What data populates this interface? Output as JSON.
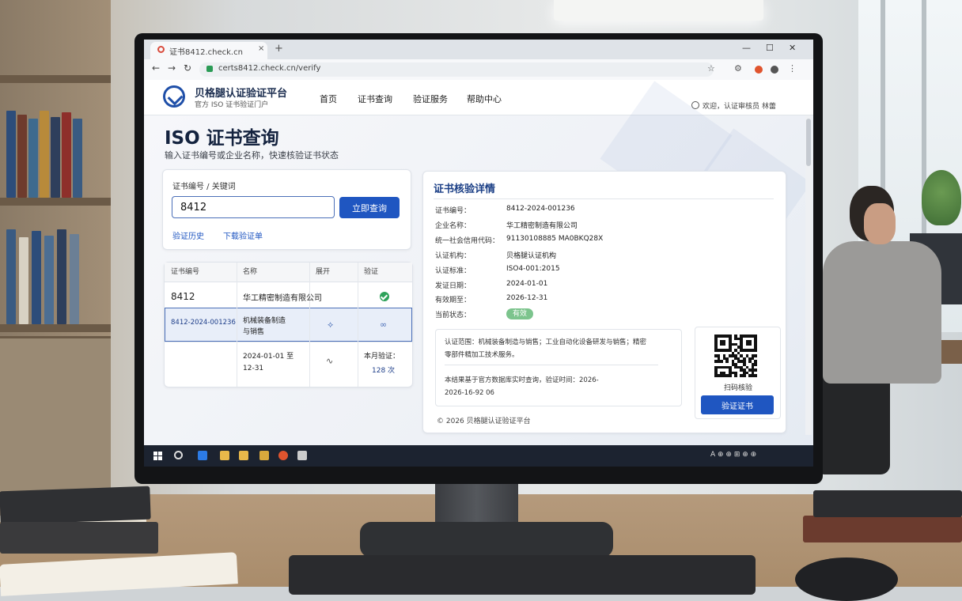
{
  "browser": {
    "tab_title": "证书8412.check.cn",
    "tab_close": "×",
    "tab_new": "+",
    "url": "certs8412.check.cn/verify",
    "window_controls": [
      "—",
      "☐",
      "✕"
    ]
  },
  "site": {
    "brand": "贝格腿认证验证平台",
    "brand_sub": "官方 ISO 证书验证门户",
    "nav": [
      "首页",
      "证书查询",
      "验证服务",
      "帮助中心"
    ],
    "header_right": "欢迎，认证审核员 林蕾"
  },
  "hero": {
    "title": "ISO 证书查询",
    "subtitle": "输入证书编号或企业名称，快速核验证书状态"
  },
  "search": {
    "label": "证书编号 / 关键词",
    "value": "8412",
    "button": "立即查询",
    "links": [
      "验证历史",
      "下载验证单"
    ]
  },
  "results": {
    "headers": [
      "证书编号",
      "名称",
      "展开",
      "验证"
    ],
    "rows": [
      {
        "id": "8412",
        "name": "华工精密制造有限公司",
        "status": "valid"
      },
      {
        "id": "8412-2024-001236",
        "name1": "机械装备制造",
        "name2": "与销售"
      },
      {
        "id": "",
        "date1": "2024-01-01 至",
        "date2": "12-31",
        "count1": "本月验证：",
        "count2": "128 次"
      }
    ]
  },
  "details": {
    "title": "证书核验详情",
    "fields": [
      {
        "key": "证书编号：",
        "value": "8412-2024-001236"
      },
      {
        "key": "企业名称：",
        "value": "华工精密制造有限公司"
      },
      {
        "key": "统一社会信用代码：",
        "value": "91130108885 MA0BKQ28X"
      },
      {
        "key": "认证机构：",
        "value": "贝格腿认证机构"
      },
      {
        "key": "认证标准：",
        "value": "ISO4-001:2015"
      },
      {
        "key": "发证日期：",
        "value": "2024-01-01"
      },
      {
        "key": "有效期至：",
        "value": "2026-12-31"
      },
      {
        "key": "当前状态：",
        "value": ""
      }
    ],
    "status": "有效",
    "scope_line1": "认证范围：机械装备制造与销售；工业自动化设备研发与销售；精密",
    "scope_line2": "零部件精加工技术服务。",
    "result_line1": "本结果基于官方数据库实时查询，验证时间：2026-",
    "result_line2": "2026-16-92 06",
    "qr_label": "扫码核验",
    "verify_button": "验证证书",
    "footer": "© 2026 贝格腿认证验证平台"
  },
  "taskbar": {
    "tray": "A ⊕ ⊕ ⊞ ⊕ ⊕"
  },
  "colors": {
    "accent": "#1f56c1",
    "valid": "#2ea25a",
    "status_pill": "#7cc48d"
  }
}
